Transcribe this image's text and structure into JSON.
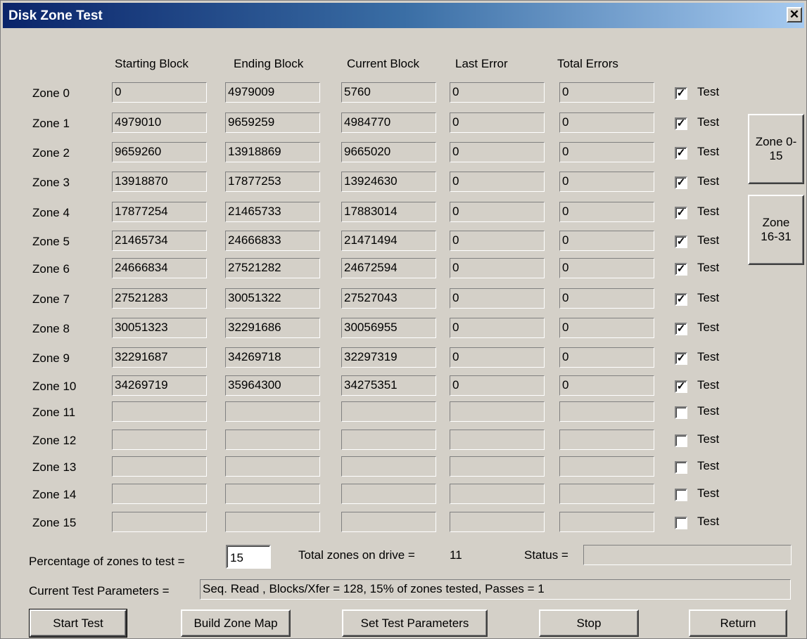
{
  "window": {
    "title": "Disk Zone Test",
    "close_glyph": "✕"
  },
  "columns": [
    "Starting Block",
    "Ending Block",
    "Current Block",
    "Last Error",
    "Total Errors"
  ],
  "check_label": "Test",
  "check_glyph": "✓",
  "zones": [
    {
      "label": "Zone 0",
      "start": "0",
      "end": "4979009",
      "current": "5760",
      "last_error": "0",
      "total_errors": "0",
      "checked": true
    },
    {
      "label": "Zone 1",
      "start": "4979010",
      "end": "9659259",
      "current": "4984770",
      "last_error": "0",
      "total_errors": "0",
      "checked": true
    },
    {
      "label": "Zone 2",
      "start": "9659260",
      "end": "13918869",
      "current": "9665020",
      "last_error": "0",
      "total_errors": "0",
      "checked": true
    },
    {
      "label": "Zone 3",
      "start": "13918870",
      "end": "17877253",
      "current": "13924630",
      "last_error": "0",
      "total_errors": "0",
      "checked": true
    },
    {
      "label": "Zone 4",
      "start": "17877254",
      "end": "21465733",
      "current": "17883014",
      "last_error": "0",
      "total_errors": "0",
      "checked": true
    },
    {
      "label": "Zone 5",
      "start": "21465734",
      "end": "24666833",
      "current": "21471494",
      "last_error": "0",
      "total_errors": "0",
      "checked": true
    },
    {
      "label": "Zone 6",
      "start": "24666834",
      "end": "27521282",
      "current": "24672594",
      "last_error": "0",
      "total_errors": "0",
      "checked": true
    },
    {
      "label": "Zone 7",
      "start": "27521283",
      "end": "30051322",
      "current": "27527043",
      "last_error": "0",
      "total_errors": "0",
      "checked": true
    },
    {
      "label": "Zone 8",
      "start": "30051323",
      "end": "32291686",
      "current": "30056955",
      "last_error": "0",
      "total_errors": "0",
      "checked": true
    },
    {
      "label": "Zone 9",
      "start": "32291687",
      "end": "34269718",
      "current": "32297319",
      "last_error": "0",
      "total_errors": "0",
      "checked": true
    },
    {
      "label": "Zone 10",
      "start": "34269719",
      "end": "35964300",
      "current": "34275351",
      "last_error": "0",
      "total_errors": "0",
      "checked": true
    },
    {
      "label": "Zone 11",
      "start": "",
      "end": "",
      "current": "",
      "last_error": "",
      "total_errors": "",
      "checked": false
    },
    {
      "label": "Zone 12",
      "start": "",
      "end": "",
      "current": "",
      "last_error": "",
      "total_errors": "",
      "checked": false
    },
    {
      "label": "Zone 13",
      "start": "",
      "end": "",
      "current": "",
      "last_error": "",
      "total_errors": "",
      "checked": false
    },
    {
      "label": "Zone 14",
      "start": "",
      "end": "",
      "current": "",
      "last_error": "",
      "total_errors": "",
      "checked": false
    },
    {
      "label": "Zone 15",
      "start": "",
      "end": "",
      "current": "",
      "last_error": "",
      "total_errors": "",
      "checked": false
    }
  ],
  "side_buttons": {
    "zone_0_15": "Zone 0-15",
    "zone_16_31": "Zone 16-31"
  },
  "bottom": {
    "percentage_label": "Percentage of zones to test =",
    "percentage_value": "15",
    "total_zones_label": "Total zones on drive =",
    "total_zones_value": "11",
    "status_label": "Status =",
    "status_value": "",
    "params_label": "Current Test Parameters =",
    "params_value": "Seq. Read , Blocks/Xfer = 128, 15% of zones tested, Passes = 1"
  },
  "buttons": {
    "start_test": "Start Test",
    "build_zone_map": "Build Zone Map",
    "set_test_parameters": "Set Test Parameters",
    "stop": "Stop",
    "return": "Return"
  }
}
